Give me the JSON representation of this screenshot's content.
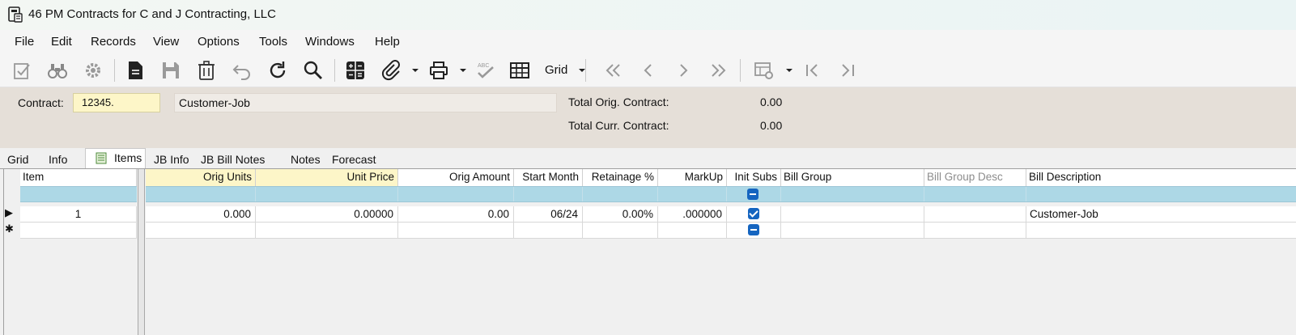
{
  "window": {
    "title": "46 PM Contracts for C and J Contracting, LLC"
  },
  "menu": [
    "File",
    "Edit",
    "Records",
    "View",
    "Options",
    "Tools",
    "Windows",
    "Help"
  ],
  "toolbar": {
    "grid_label": "Grid",
    "spell_label": "ABC"
  },
  "header": {
    "contract_label": "Contract:",
    "contract_value": "12345.",
    "customer_value": "Customer-Job",
    "total_orig_label": "Total Orig. Contract:",
    "total_orig_value": "0.00",
    "total_curr_label": "Total Curr. Contract:",
    "total_curr_value": "0.00"
  },
  "tabs": [
    "Grid",
    "Info",
    "Items",
    "JB Info",
    "JB Bill Notes",
    "Notes",
    "Forecast"
  ],
  "active_tab": "Items",
  "grid": {
    "columns": [
      "Item",
      "Orig Units",
      "Unit Price",
      "Orig Amount",
      "Start Month",
      "Retainage %",
      "MarkUp",
      "Init Subs",
      "Bill Group",
      "Bill Group Desc",
      "Bill Description"
    ],
    "rows": [
      {
        "item": "1",
        "orig_units": "0.000",
        "unit_price": "0.00000",
        "orig_amount": "0.00",
        "start_month": "06/24",
        "retainage": "0.00%",
        "markup": ".000000",
        "init_subs": true,
        "bill_group": "",
        "bill_group_desc": "",
        "bill_description": "Customer-Job"
      }
    ],
    "current_row_marker": "▶",
    "new_row_marker": "✱"
  },
  "colors": {
    "required_field": "#fdf6c8",
    "filter_row": "#add8e6",
    "header_panel": "#e5dfd8",
    "checkbox": "#1565c0"
  }
}
